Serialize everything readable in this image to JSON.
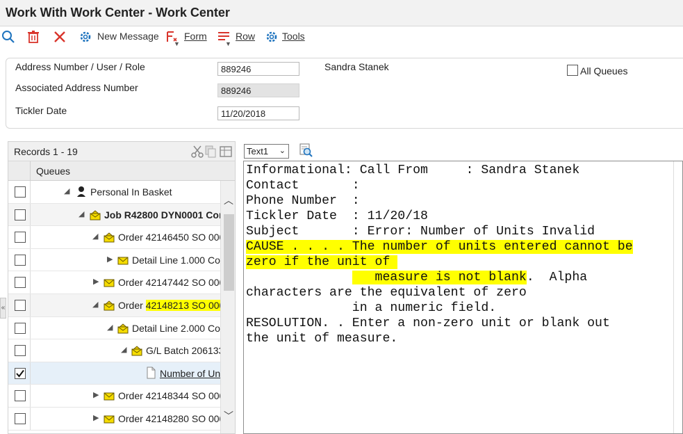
{
  "window": {
    "title": "Work With Work Center - Work Center"
  },
  "toolbar": {
    "new_message_label": "New Message",
    "form_label": "Form",
    "row_label": "Row",
    "tools_label": "Tools"
  },
  "header": {
    "address_label": "Address Number / User / Role",
    "address_value": "889246",
    "address_name": "Sandra Stanek",
    "assoc_label": "Associated Address Number",
    "assoc_value": "889246",
    "tickler_label": "Tickler Date",
    "tickler_value": "11/20/2018",
    "all_queues_label": "All Queues"
  },
  "grid": {
    "records_label": "Records 1 - 19",
    "column_header": "Queues",
    "rows": [
      {
        "label": "Personal In Basket",
        "checked": false
      },
      {
        "label": "Job R42800 DYN0001 Com",
        "checked": false
      },
      {
        "label": "Order 42146450 SO 000",
        "checked": false
      },
      {
        "label": "Detail Line 1.000 Con",
        "checked": false
      },
      {
        "label": "Order 42147442 SO 000",
        "checked": false
      },
      {
        "label_prefix": "Order ",
        "label_highlight": "42148213 SO 000",
        "checked": false
      },
      {
        "label": "Detail Line 2.000 Con",
        "checked": false
      },
      {
        "label": "G/L Batch 206133",
        "checked": false
      },
      {
        "label": "Number of Uni",
        "checked": true
      },
      {
        "label": "Order 42148344 SO 000",
        "checked": false
      },
      {
        "label": "Order 42148280 SO 000",
        "checked": false
      }
    ]
  },
  "text_view": {
    "selector_value": "Text1",
    "lines": {
      "l1": "Informational: Call From     : Sandra Stanek",
      "l2": "Contact       :",
      "l3": "Phone Number  :",
      "l4": "Tickler Date  : 11/20/18",
      "l5": "Subject       : Error: Number of Units Invalid",
      "l6": "CAUSE . . . . The number of units entered cannot be",
      "l7": "zero if the unit of ",
      "l8_pad": "              ",
      "l8_hl": "   measure is not blank",
      "l8_rest": ".  Alpha",
      "l9": "characters are the equivalent of zero",
      "l10": "              in a numeric field.",
      "l11": "RESOLUTION. . Enter a non-zero unit or blank out",
      "l12": "the unit of measure."
    }
  },
  "colors": {
    "highlight": "#ffff00",
    "accent_blue": "#1e73be",
    "delete_red": "#d9342b"
  }
}
